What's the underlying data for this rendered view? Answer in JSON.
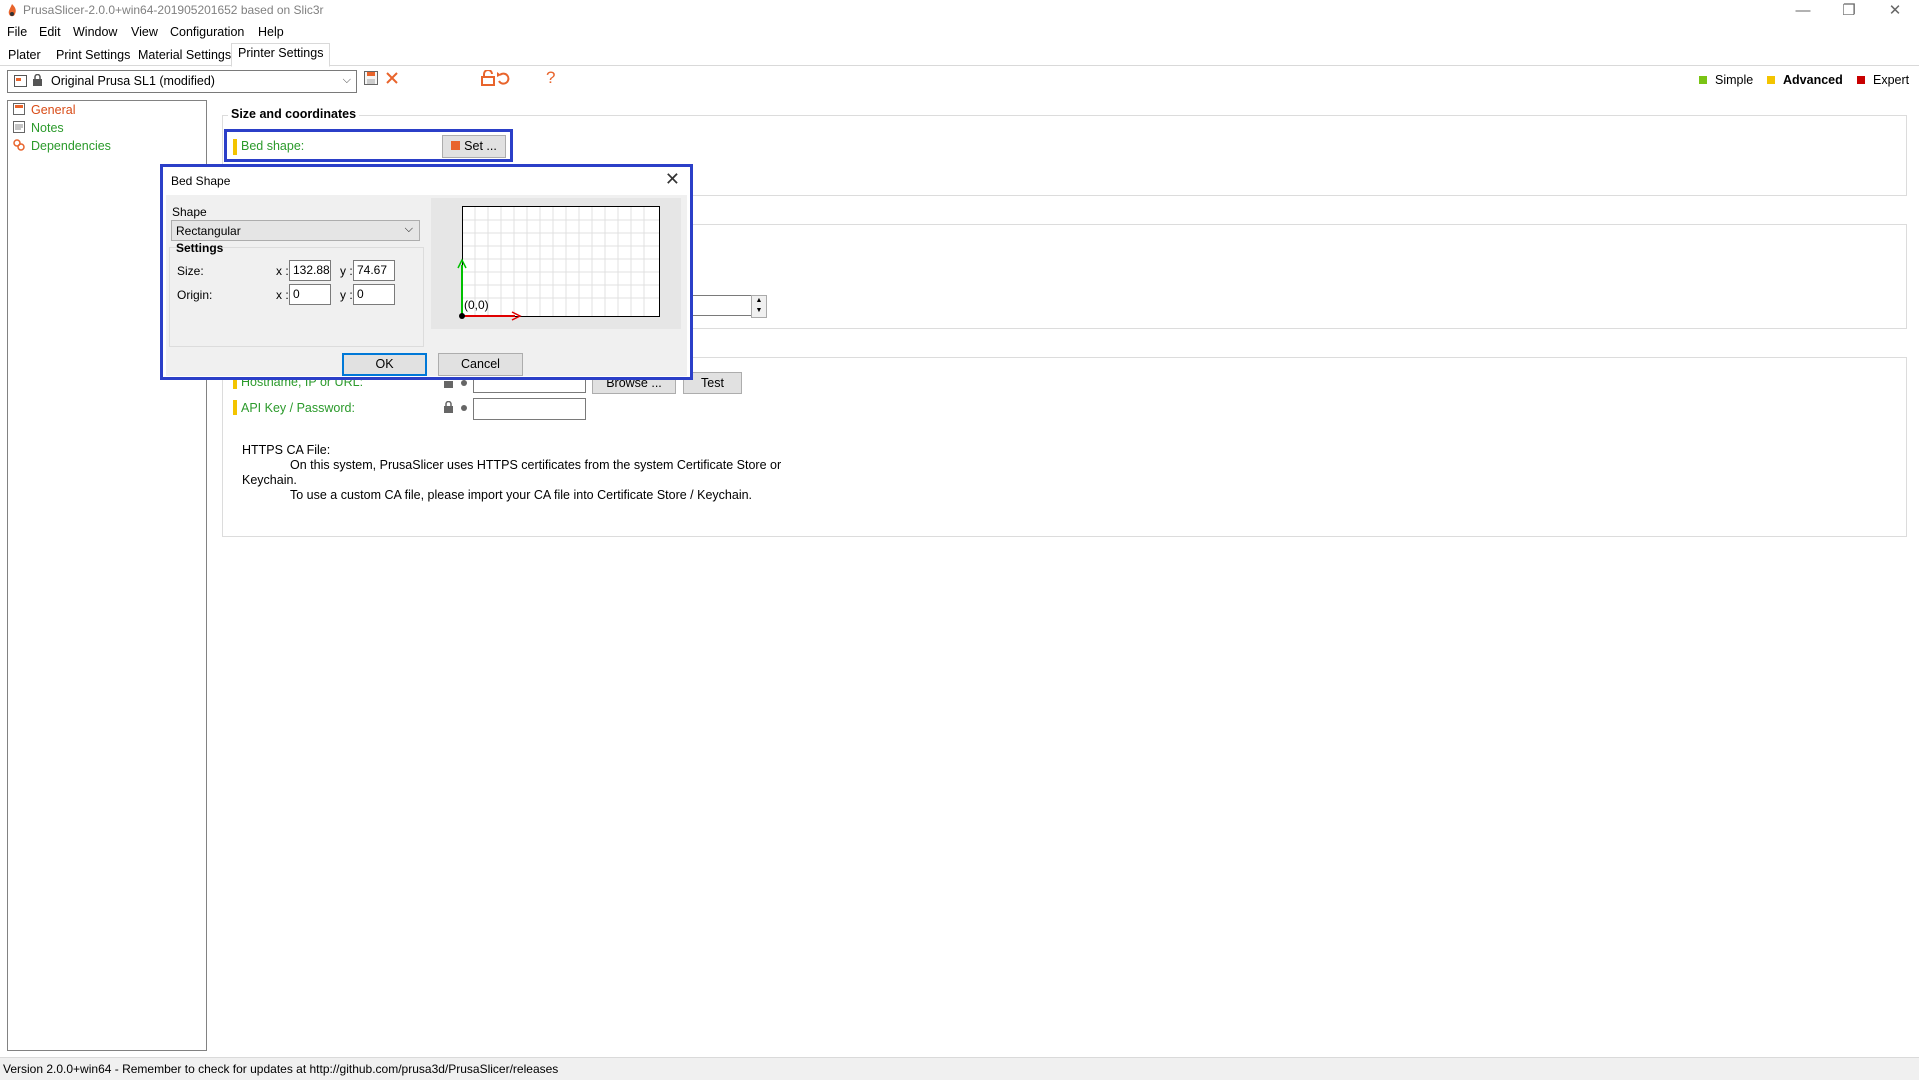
{
  "window": {
    "title": "PrusaSlicer-2.0.0+win64-201905201652 based on Slic3r",
    "min_glyph": "—",
    "restore_glyph": "❐",
    "close_glyph": "✕"
  },
  "menu": [
    "File",
    "Edit",
    "Window",
    "View",
    "Configuration",
    "Help"
  ],
  "tabs": [
    "Plater",
    "Print Settings",
    "Material Settings",
    "Printer Settings"
  ],
  "active_tab": "Printer Settings",
  "preset": {
    "name": "Original Prusa SL1 (modified)",
    "help_glyph": "?"
  },
  "modes": [
    {
      "label": "Simple",
      "color": "#7ac414"
    },
    {
      "label": "Advanced",
      "color": "#f3c400"
    },
    {
      "label": "Expert",
      "color": "#c80000"
    }
  ],
  "sidebar": {
    "items": [
      {
        "label": "General",
        "color": "#d84b16"
      },
      {
        "label": "Notes",
        "color": "#2b9a2b"
      },
      {
        "label": "Dependencies",
        "color": "#2b9a2b"
      }
    ]
  },
  "size_group": {
    "title": "Size and coordinates",
    "bed_shape_label": "Bed shape:",
    "set_button": "Set ..."
  },
  "host_group": {
    "hostname_label": "Hostname, IP or URL:",
    "browse_button": "Browse ...",
    "test_button": "Test",
    "api_label": "API Key / Password:",
    "ca_title": "HTTPS CA File:",
    "ca_line1": "On this system, PrusaSlicer uses HTTPS certificates from the system Certificate Store or",
    "ca_line2": "Keychain.",
    "ca_line3": "To use a custom CA file, please import your CA file into Certificate Store / Keychain."
  },
  "dialog": {
    "title": "Bed Shape",
    "shape_label": "Shape",
    "shape_value": "Rectangular",
    "settings_label": "Settings",
    "size_label": "Size:",
    "origin_label": "Origin:",
    "x_label": "x :",
    "y_label": "y :",
    "size_x": "132.88",
    "size_y": "74.67",
    "origin_x": "0",
    "origin_y": "0",
    "origin_marker": "(0,0)",
    "ok": "OK",
    "cancel": "Cancel"
  },
  "status": "Version 2.0.0+win64 - Remember to check for updates at http://github.com/prusa3d/PrusaSlicer/releases",
  "colors": {
    "highlight": "#2b3fc8",
    "label_green": "#2b9a2b",
    "accent_orange": "#e8642c"
  }
}
